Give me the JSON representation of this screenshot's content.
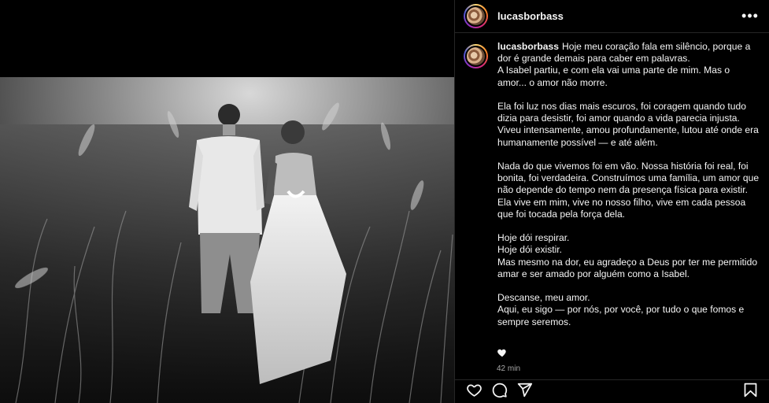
{
  "post": {
    "username": "lucasborbass",
    "more_label": "•••",
    "caption": {
      "username": "lucasborbass",
      "paragraphs": [
        "Hoje meu coração fala em silêncio, porque a dor é grande demais para caber em palavras.",
        "A Isabel partiu, e com ela vai uma parte de mim. Mas o amor... o amor não morre.",
        "",
        "Ela foi luz nos dias mais escuros, foi coragem quando tudo dizia para desistir, foi amor quando a vida parecia injusta. Viveu intensamente, amou profundamente, lutou até onde era humanamente possível — e até além.",
        "",
        "Nada do que vivemos foi em vão. Nossa história foi real, foi bonita, foi verdadeira. Construímos uma família, um amor que não depende do tempo nem da presença física para existir. Ela vive em mim, vive no nosso filho, vive em cada pessoa que foi tocada pela força dela.",
        "",
        "Hoje dói respirar.",
        "Hoje dói existir.",
        "Mas mesmo na dor, eu agradeço a Deus por ter me permitido amar e ser amado por alguém como a Isabel.",
        "",
        "Descanse, meu amor.",
        "Aqui, eu sigo — por nós, por você, por tudo o que fomos e sempre seremos."
      ]
    },
    "time_ago": "42 min"
  },
  "icons": {
    "more": "more-options-icon",
    "like": "heart-icon",
    "comment": "comment-icon",
    "share": "share-icon",
    "save": "bookmark-icon"
  },
  "colors": {
    "background": "#000000",
    "text": "#f5f5f5",
    "muted": "#a8a8a8",
    "divider": "#262626"
  }
}
